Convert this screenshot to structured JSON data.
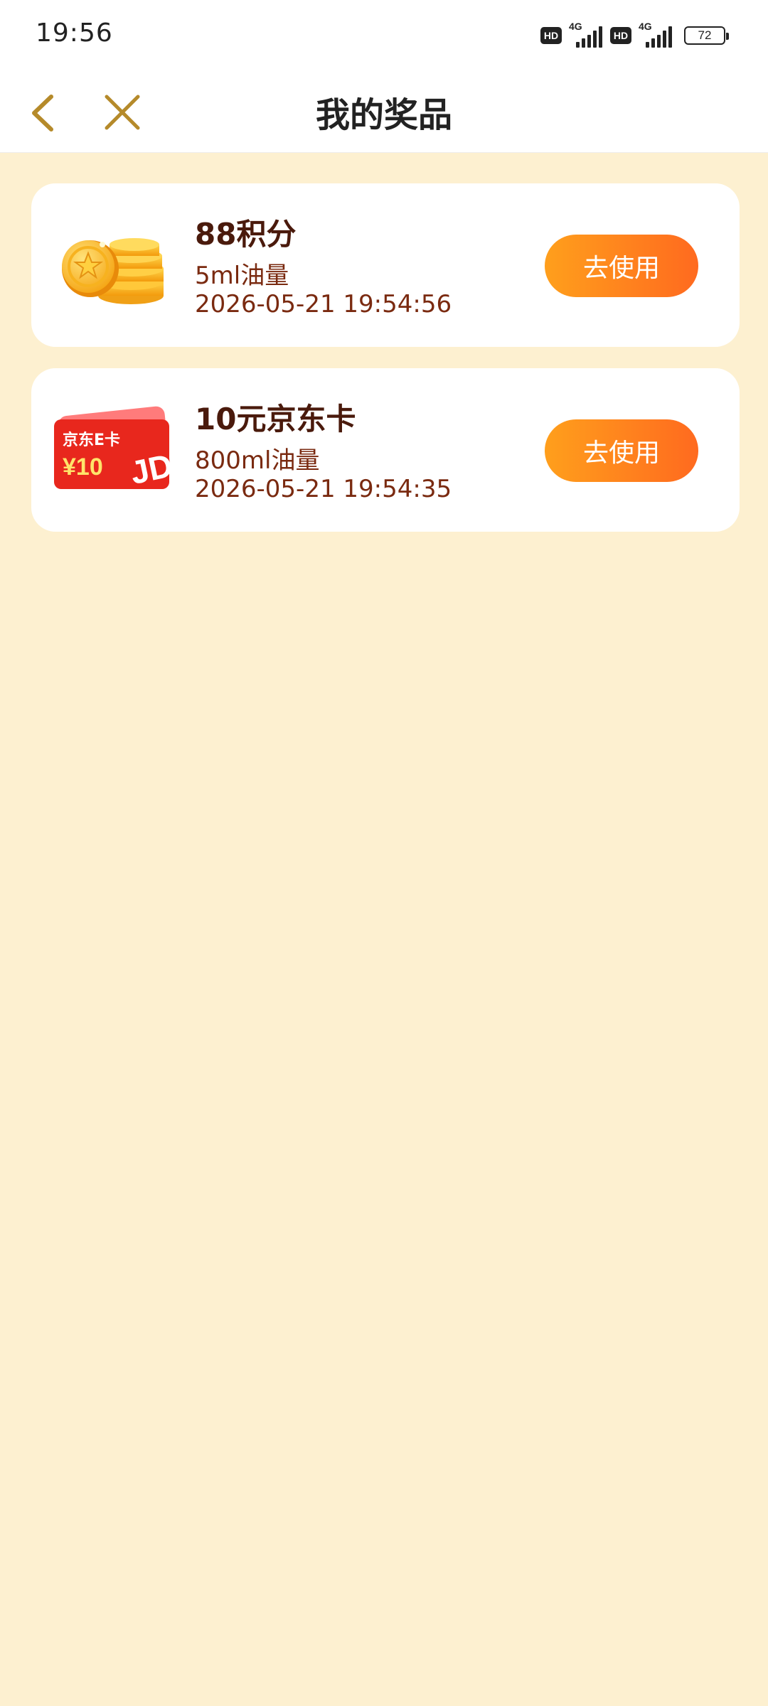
{
  "status_bar": {
    "time": "19:56",
    "hd_badge": "HD",
    "network": "4G",
    "battery": "72"
  },
  "nav": {
    "title": "我的奖品",
    "back_icon": "chevron-left-icon",
    "close_icon": "close-icon"
  },
  "prizes": [
    {
      "title": "88积分",
      "subtitle": "5ml油量",
      "time": "2026-05-21 19:54:56",
      "button": "去使用",
      "icon": "coins-icon"
    },
    {
      "title": "10元京东卡",
      "subtitle": "800ml油量",
      "time": "2026-05-21 19:54:35",
      "button": "去使用",
      "icon": "jd-card-icon",
      "card_text": "京东E卡",
      "card_value": "¥10",
      "card_logo": "JD"
    }
  ],
  "colors": {
    "page_bg": "#fdf0d0",
    "accent_start": "#ff9f1c",
    "accent_end": "#ff6a1f",
    "title_text": "#4a1a0c",
    "sub_text": "#7a2a10",
    "nav_icon": "#b58a2a"
  }
}
